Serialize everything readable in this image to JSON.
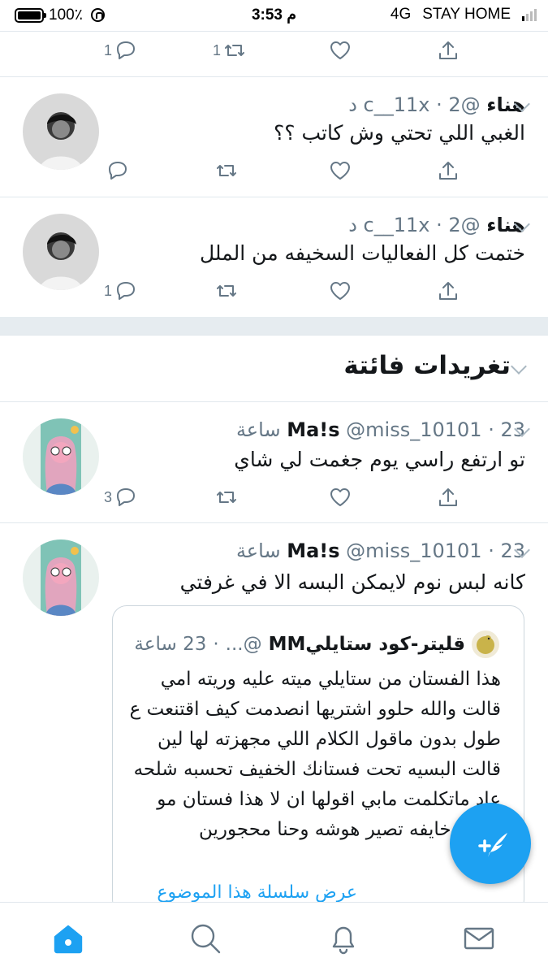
{
  "status_bar": {
    "battery": "100٪",
    "time": "3:53 م",
    "network": "4G",
    "carrier": "STAY HOME"
  },
  "top_actions": {
    "reply_count": "1",
    "retweet_count": "1"
  },
  "tweets": [
    {
      "name": "هناء",
      "handle": "@c__11x",
      "time": "2 د",
      "text": "الغبي اللي تحتي وش كاتب ؟؟",
      "reply_count": "",
      "retweet_count": ""
    },
    {
      "name": "هناء",
      "handle": "@c__11x",
      "time": "2 د",
      "text": "ختمت كل الفعاليات السخيفه من الملل",
      "reply_count": "1",
      "retweet_count": ""
    },
    {
      "name": "Ma!s",
      "handle": "@miss_10101",
      "time": "23 ساعة",
      "text": "تو ارتفع راسي يوم جغمت لي شاي",
      "reply_count": "3",
      "retweet_count": ""
    },
    {
      "name": "Ma!s",
      "handle": "@miss_10101",
      "time": "23 ساعة",
      "text": "كانه لبس نوم لايمكن البسه الا في غرفتي",
      "reply_count": "",
      "retweet_count": ""
    }
  ],
  "section_title": "تغريدات فائتة",
  "quote": {
    "name": "قليتر-كود ستايليMM",
    "handle": "@...",
    "time": "23 ساعة",
    "text": "هذا الفستان من ستايلي ميته عليه وريته امي قالت والله حلوو اشتريها انصدمت كيف اقتنعت ع طول بدون ماقول الكلام اللي مجهزته لها لين قالت البسيه تحت فستانك الخفيف تحسبه شلحه عاد ماتكلمت مابي اقولها ان لا هذا فستان مو شلحه خايفه تصير هوشه وحنا محجورين",
    "thread_link": "عرض سلسلة هذا الموضوع"
  },
  "colors": {
    "accent": "#1da1f2",
    "muted": "#657786",
    "band": "#e6ecf0"
  },
  "icons": [
    "reply-icon",
    "retweet-icon",
    "like-icon",
    "share-icon",
    "compose-icon",
    "home-icon",
    "search-icon",
    "notifications-icon",
    "messages-icon"
  ]
}
